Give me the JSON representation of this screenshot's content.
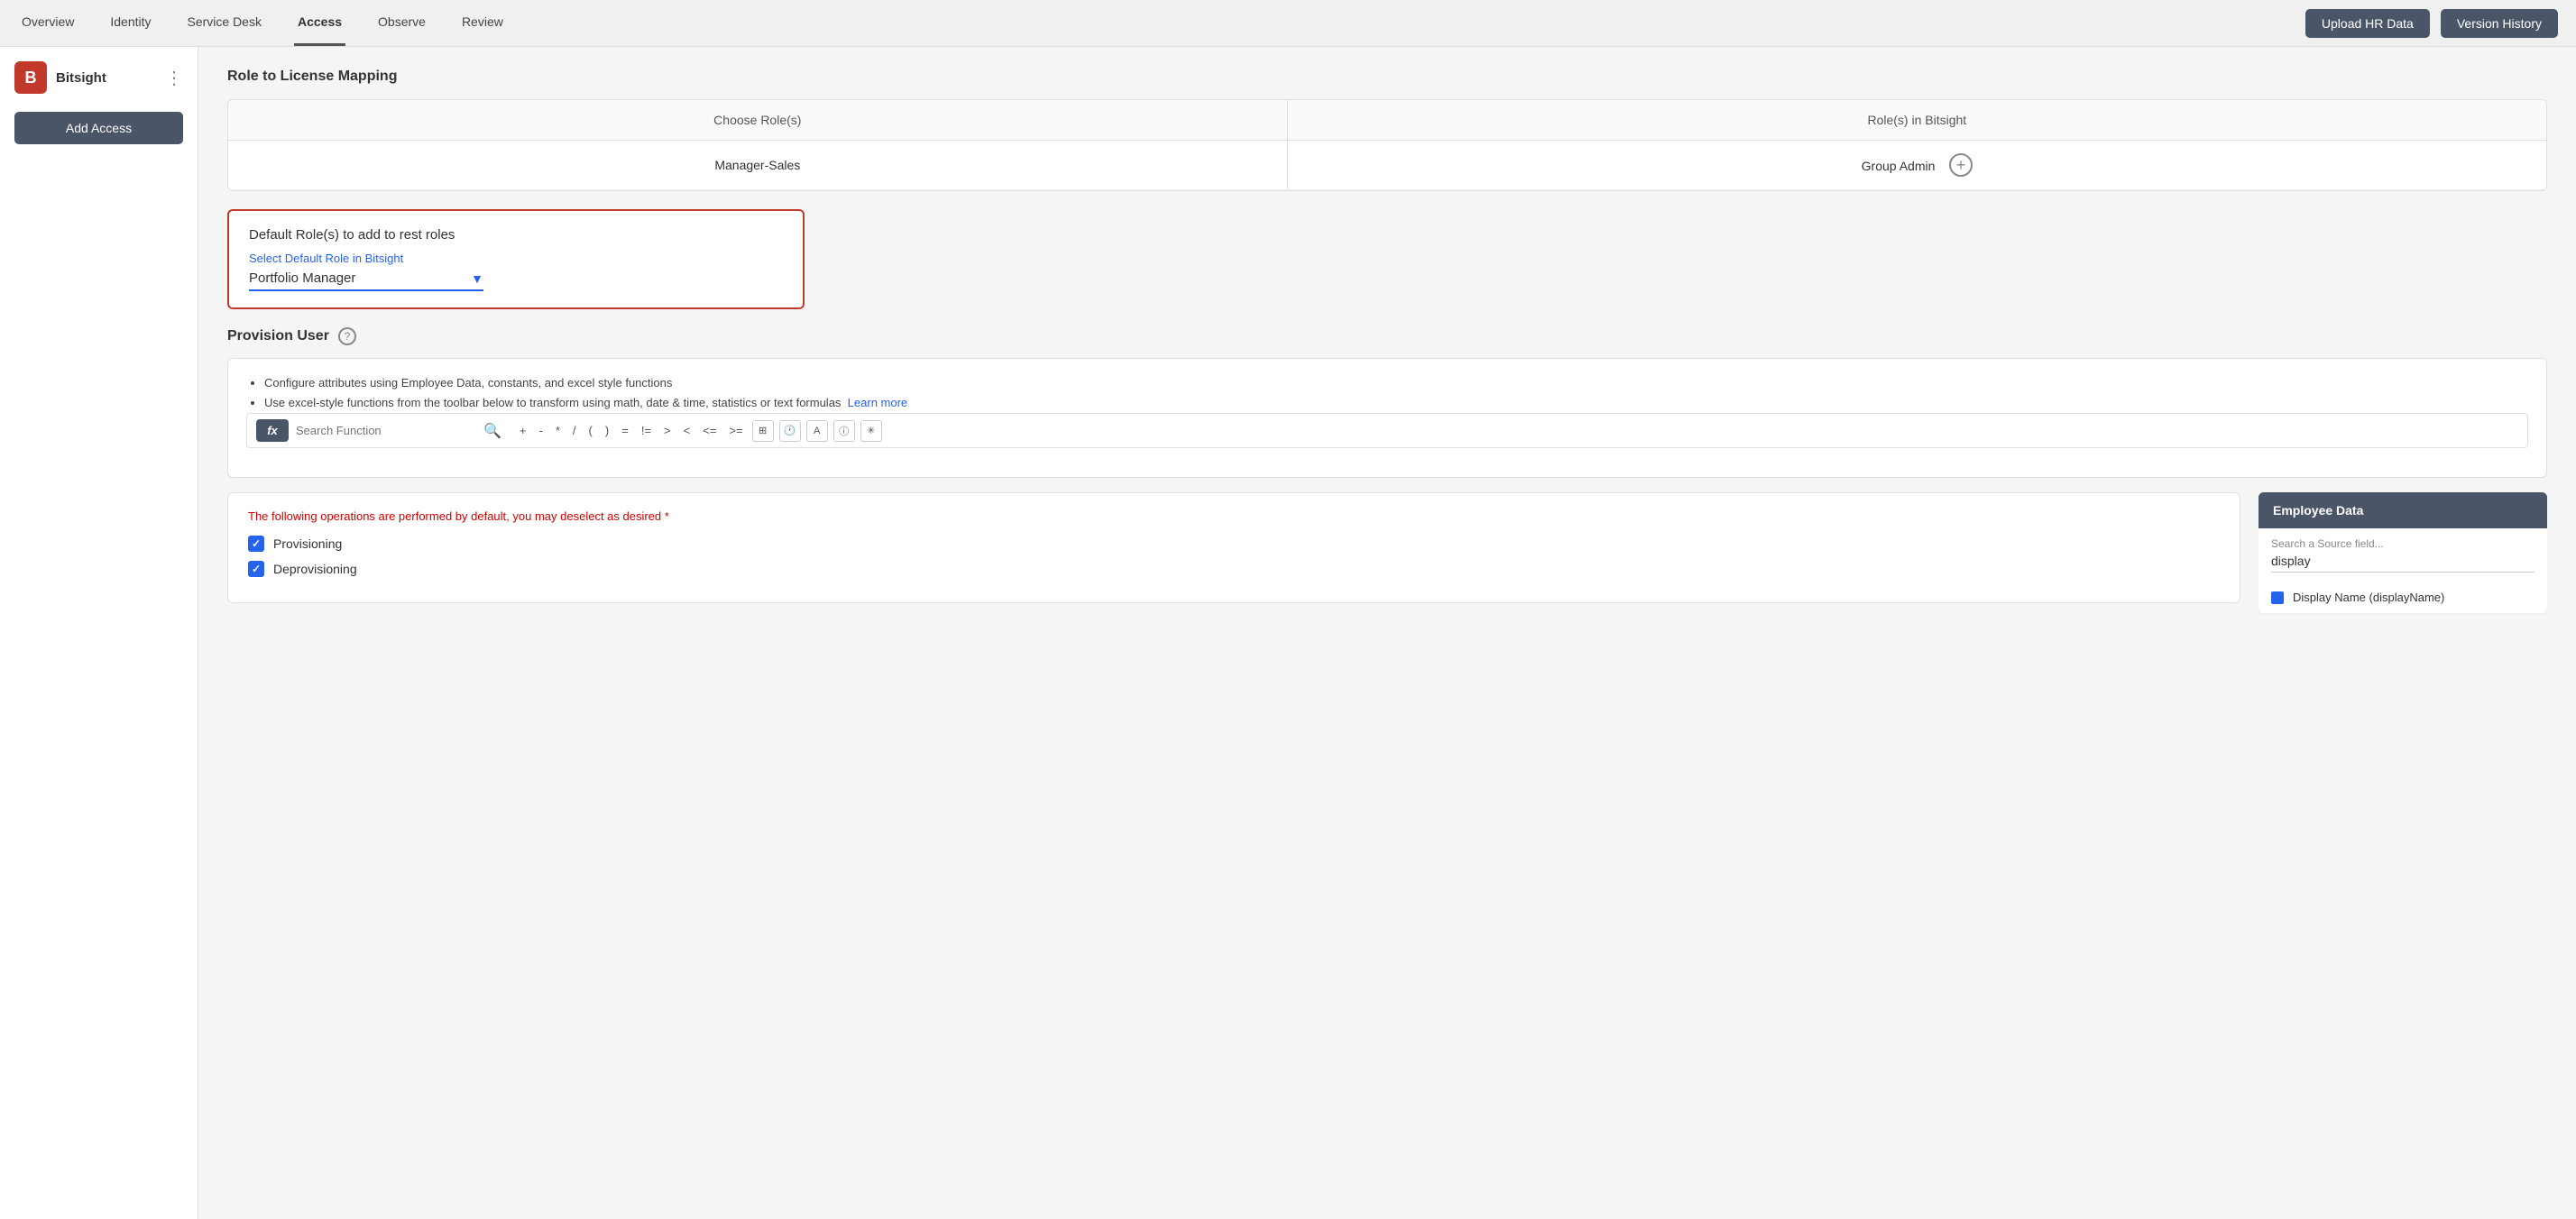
{
  "nav": {
    "items": [
      {
        "label": "Overview",
        "active": false
      },
      {
        "label": "Identity",
        "active": false
      },
      {
        "label": "Service Desk",
        "active": false
      },
      {
        "label": "Access",
        "active": true
      },
      {
        "label": "Observe",
        "active": false
      },
      {
        "label": "Review",
        "active": false
      }
    ],
    "upload_hr_label": "Upload HR Data",
    "version_history_label": "Version History"
  },
  "sidebar": {
    "brand_letter": "B",
    "brand_name": "Bitsight",
    "add_access_label": "Add Access"
  },
  "role_mapping": {
    "title": "Role to License Mapping",
    "col_roles": "Choose Role(s)",
    "col_bitsight": "Role(s) in Bitsight",
    "row_role": "Manager-Sales",
    "row_bitsight": "Group Admin"
  },
  "default_role": {
    "title": "Default Role(s) to add to rest roles",
    "label": "Select Default Role in Bitsight",
    "value": "Portfolio Manager"
  },
  "provision": {
    "title": "Provision User",
    "bullet1": "Configure attributes using Employee Data, constants, and excel style functions",
    "bullet2": "Use excel-style functions from the toolbar below to transform using math, date & time, statistics or text formulas",
    "learn_more": "Learn more",
    "fx_label": "fx",
    "search_placeholder": "Search Function",
    "ops": [
      "+",
      "-",
      "*",
      "/",
      "(",
      ")",
      "=",
      "!=",
      ">",
      "<",
      "<=",
      ">="
    ],
    "toolbar_icons": [
      "grid-icon",
      "clock-icon",
      "font-icon",
      "info-icon",
      "sparkle-icon"
    ]
  },
  "operations": {
    "description": "The following operations are performed by default, you may deselect as desired",
    "asterisk": "*",
    "items": [
      {
        "label": "Provisioning",
        "checked": true
      },
      {
        "label": "Deprovisioning",
        "checked": true
      }
    ]
  },
  "employee_data": {
    "title": "Employee Data",
    "search_label": "Search a Source field...",
    "search_value": "display",
    "items": [
      {
        "label": "Display Name (displayName)"
      }
    ]
  }
}
